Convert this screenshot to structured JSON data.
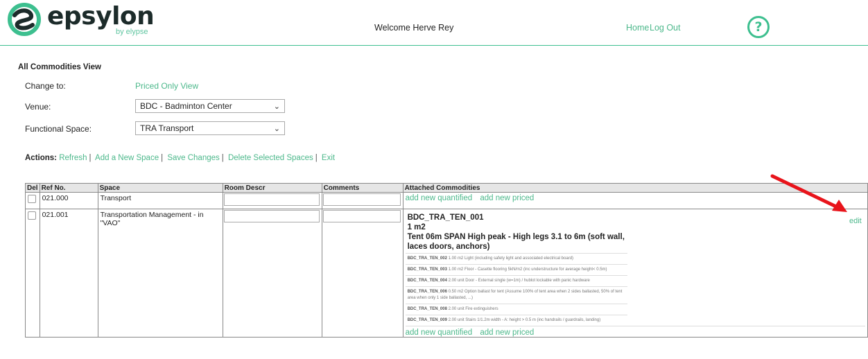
{
  "header": {
    "brand": "epsylon",
    "by_line": "by elypse",
    "welcome": "Welcome Herve Rey",
    "nav_home": "Home",
    "nav_logout": "Log Out",
    "help_icon": "?"
  },
  "view": {
    "title": "All Commodities View",
    "change_to_label": "Change to:",
    "change_to_link": "Priced Only View",
    "venue_label": "Venue:",
    "venue_value": "BDC - Badminton Center",
    "space_label": "Functional Space:",
    "space_value": "TRA Transport"
  },
  "actions": {
    "label": "Actions:",
    "refresh": "Refresh",
    "add_space": "Add a New Space",
    "save": "Save Changes",
    "delete": "Delete Selected Spaces",
    "exit": "Exit"
  },
  "table": {
    "headers": [
      "Del",
      "Ref No.",
      "Space",
      "Room Descr",
      "Comments",
      "Attached Commodities"
    ],
    "rows": [
      {
        "ref": "021.000",
        "space": "Transport"
      },
      {
        "ref": "021.001",
        "space": "Transportation Management - in \"VAO\""
      }
    ],
    "add_quantified": "add new quantified",
    "add_priced": "add new priced",
    "edit": "edit",
    "main_commodity": {
      "code": "BDC_TRA_TEN_001",
      "qty": "1 m2",
      "desc": "Tent 06m SPAN High peak - High legs 3.1 to 6m (soft wall, laces doors, anchors)"
    },
    "sub_commodities": [
      {
        "code": "BDC_TRA_TEN_002",
        "text": "1.00 m2  Light (including safety light and associated electrical board)"
      },
      {
        "code": "BDC_TRA_TEN_003",
        "text": "1.00 m2  Floor - Casette flooring 5kN/m2 (inc understructure for average height< 0.5m)"
      },
      {
        "code": "BDC_TRA_TEN_004",
        "text": "2.00 unit  Door - External single (w=1m) / hublot lockable with panic hardware"
      },
      {
        "code": "BDC_TRA_TEN_006",
        "text": "0.50 m2  Option ballast for tent (Assume 100% of tent area when 2 sides ballasted, 50% of tent area when only 1 side ballasted, ...)"
      },
      {
        "code": "BDC_TRA_TEN_008",
        "text": "2.00 unit  Fire extinguishers"
      },
      {
        "code": "BDC_TRA_TEN_009",
        "text": "2.00 unit  Stairs 1/1.2m width - A: height > 0.5 m (inc handrails / guardrails, landing)"
      }
    ]
  },
  "colors": {
    "accent": "#4cb88b",
    "arrow": "#e8141b"
  }
}
